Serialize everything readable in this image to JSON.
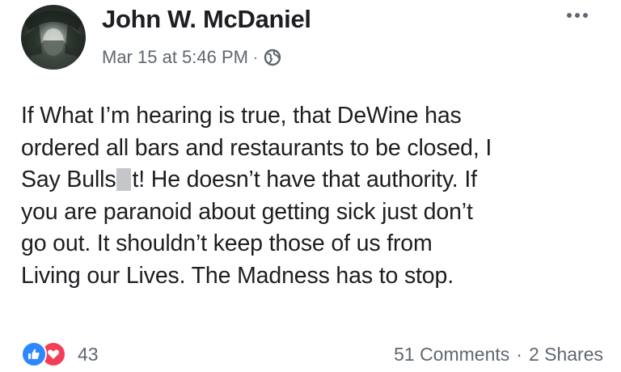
{
  "post": {
    "author": "John W. McDaniel",
    "timestamp": "Mar 15 at 5:46 PM",
    "separator": "·",
    "privacy_icon": "globe-icon",
    "more_icon": "more-options-icon",
    "text_lines": [
      "If What I’m hearing is true, that DeWine has",
      "ordered all bars and restaurants to be closed, I",
      [
        "Say Bulls",
        "t! He doesn’t have that authority. If"
      ],
      "you are paranoid about getting sick just don’t",
      "go out. It shouldn’t keep those of us from",
      "Living our Lives. The Madness has to stop."
    ]
  },
  "footer": {
    "reaction_icons": [
      "like-icon",
      "love-icon"
    ],
    "reaction_count": "43",
    "comments": "51 Comments",
    "separator": "·",
    "shares": "2 Shares"
  },
  "colors": {
    "name": "#1c1e21",
    "meta": "#606770",
    "like": "#2d88ff",
    "love": "#f33e58"
  }
}
